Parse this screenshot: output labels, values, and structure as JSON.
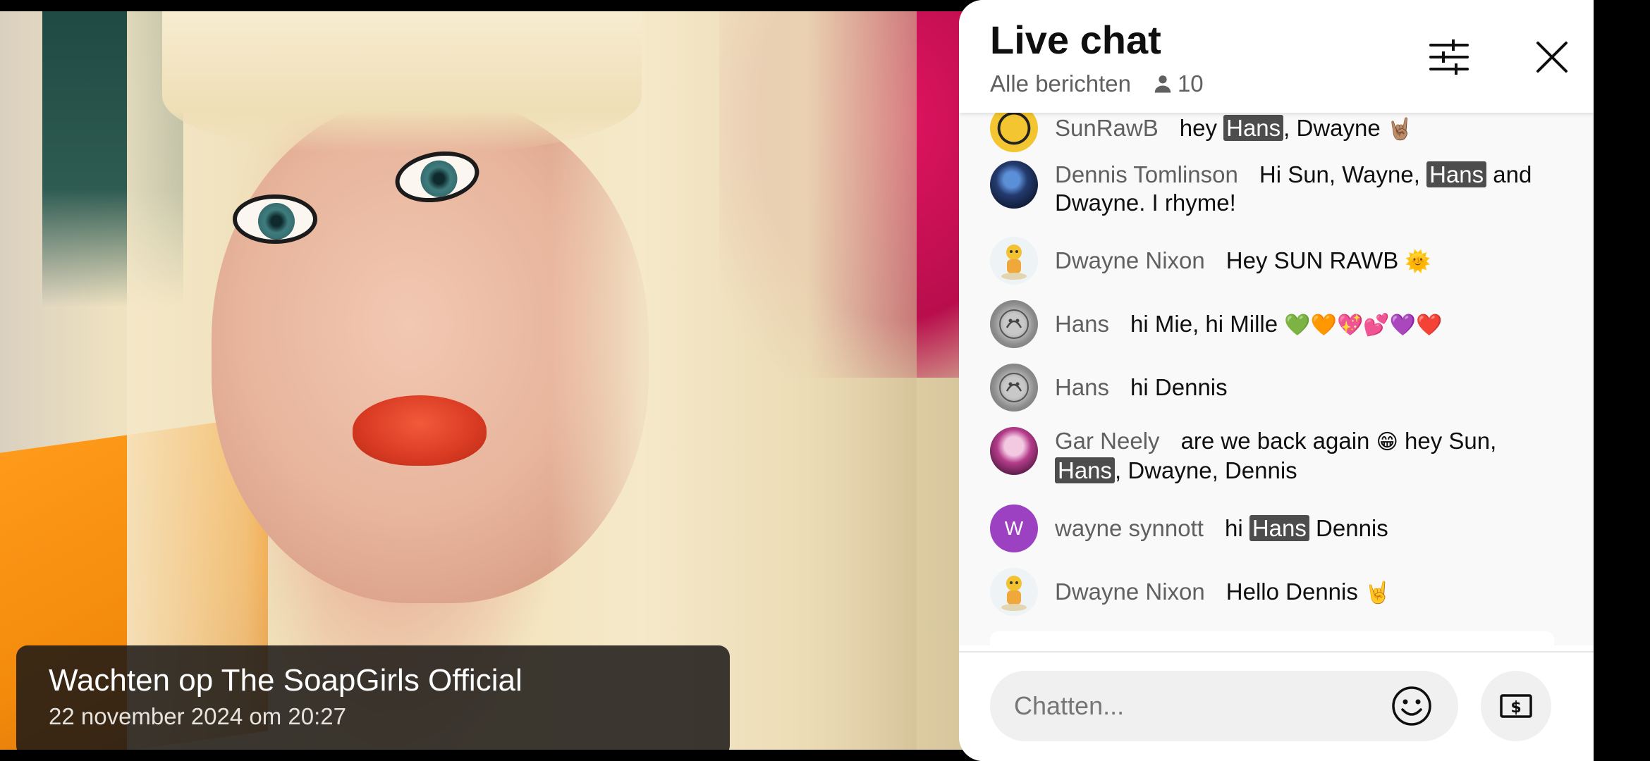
{
  "video": {
    "title": "Wachten op The SoapGirls Official",
    "date": "22 november 2024 om 20:27"
  },
  "chat": {
    "title": "Live chat",
    "filter_label": "Alle berichten",
    "viewer_count": "10",
    "input_placeholder": "Chatten...",
    "messages": [
      {
        "author": "SunRawB",
        "avatar_icon": "yellow-eye-avatar",
        "text_before": "hey ",
        "highlight": "Hans",
        "text_after": ", Dwayne ",
        "emoji": "🤘🏽"
      },
      {
        "author": "Dennis Tomlinson",
        "avatar_icon": "dark-blue-avatar",
        "text_before": "Hi Sun, Wayne, ",
        "highlight": "Hans",
        "text_after": " and Dwayne. I rhyme!"
      },
      {
        "author": "Dwayne Nixon",
        "avatar_icon": "cartoon-avatar",
        "text": "Hey SUN RAWB ",
        "emoji": "🌞"
      },
      {
        "author": "Hans",
        "avatar_icon": "grey-coin-avatar",
        "text": "hi Mie, hi Mille ",
        "emoji": "💚🧡💖💕💜❤️"
      },
      {
        "author": "Hans",
        "avatar_icon": "grey-coin-avatar",
        "text": "hi Dennis"
      },
      {
        "author": "Gar Neely",
        "avatar_icon": "doll-avatar",
        "text_before": "are we back again ",
        "emoji": "😁",
        "text_mid": " hey Sun,",
        "highlight": "Hans",
        "text_after": ", Dwayne, Dennis"
      },
      {
        "author": "wayne synnott",
        "avatar_letter": "W",
        "avatar_color": "#9b41c2",
        "text_before": "hi ",
        "highlight": "Hans",
        "text_after": " Dennis"
      },
      {
        "author": "Dwayne Nixon",
        "avatar_icon": "cartoon-avatar",
        "text": "Hello Dennis ",
        "emoji": "🤘"
      }
    ]
  }
}
